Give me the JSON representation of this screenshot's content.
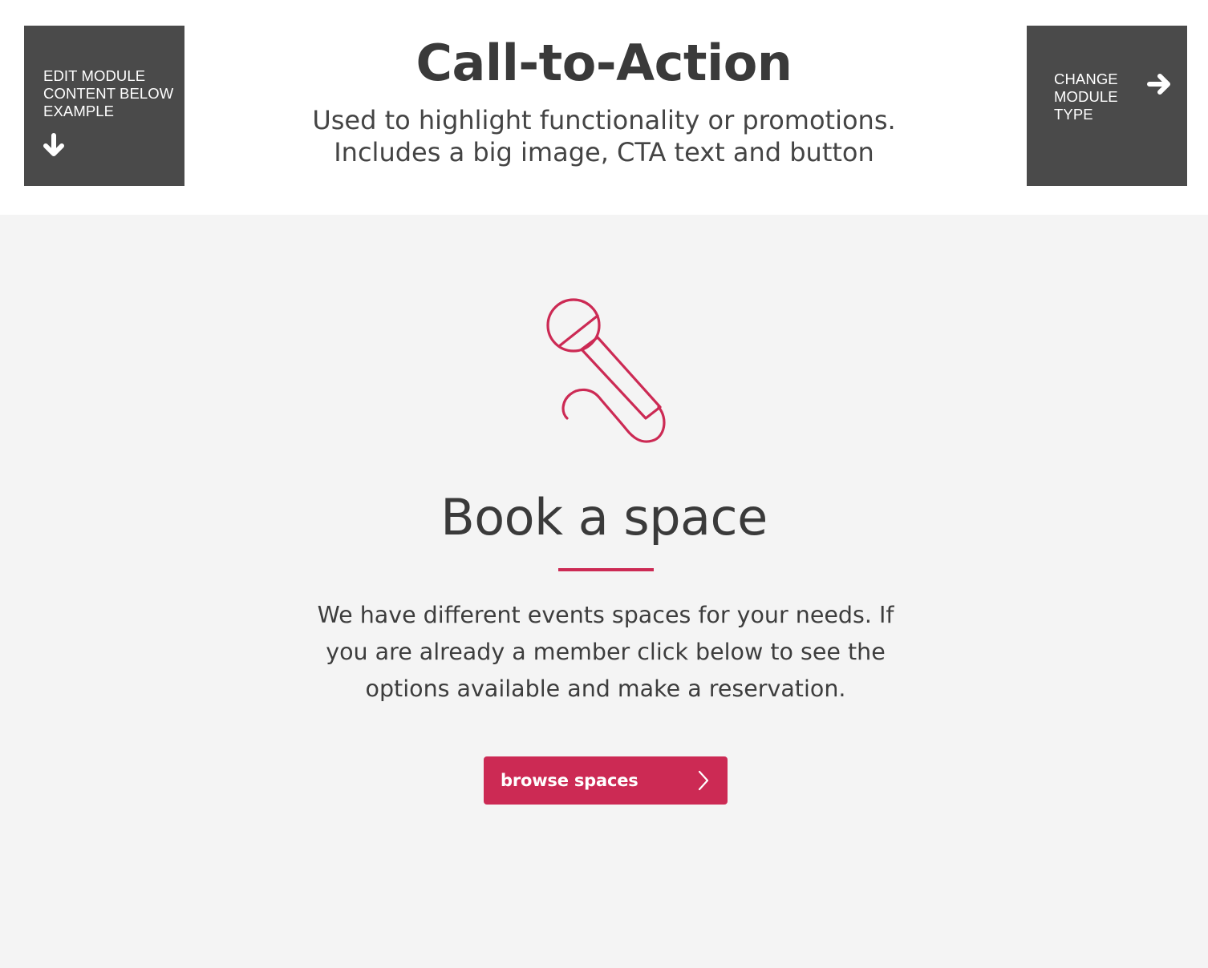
{
  "header": {
    "title": "Call-to-Action",
    "description_line1": "Used to highlight functionality or promotions.",
    "description_line2": "Includes a big image, CTA text and button",
    "edit_button": {
      "label": "Edit module content below example",
      "icon": "arrow-down-icon"
    },
    "change_button": {
      "label": "Change module type",
      "icon": "arrow-right-icon"
    }
  },
  "cta": {
    "icon": "microphone-icon",
    "title": "Book a space",
    "text": "We have different events spaces for your needs. If you are already a member click below to see the options available and make a reservation.",
    "button_label": "browse spaces",
    "button_icon": "chevron-right-icon"
  },
  "colors": {
    "accent": "#cc2a54",
    "nav_box": "#4a4a4a",
    "module_background": "#f4f4f4",
    "text": "#3a3a3a"
  }
}
